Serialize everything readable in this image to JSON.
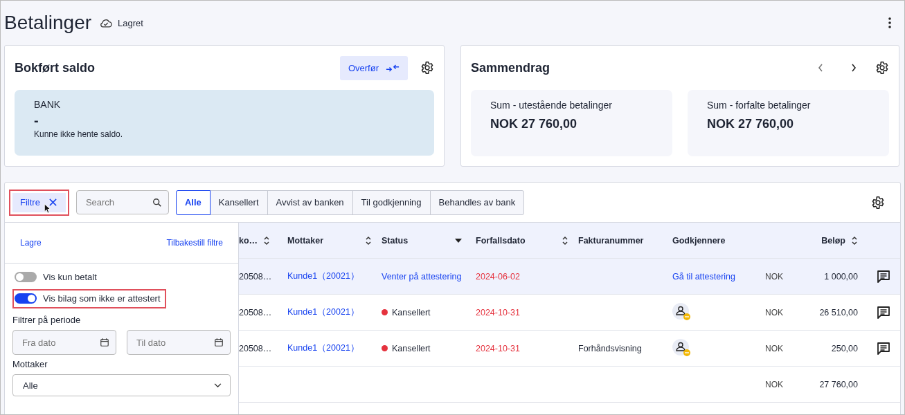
{
  "page": {
    "title": "Betalinger",
    "save_status": "Lagret"
  },
  "balance_card": {
    "title": "Bokført saldo",
    "transfer_button": "Overfør",
    "account": {
      "name": "BANK",
      "amount": "-",
      "message": "Kunne ikke hente saldo."
    }
  },
  "summary_card": {
    "title": "Sammendrag",
    "tiles": [
      {
        "label": "Sum - utestående betalinger",
        "value": "NOK 27 760,00"
      },
      {
        "label": "Sum - forfalte betalinger",
        "value": "NOK 27 760,00"
      }
    ]
  },
  "toolbar": {
    "filter_button": {
      "label": "Filtre",
      "highlighted": true
    },
    "search": {
      "placeholder": "Search"
    },
    "status_tabs": [
      {
        "label": "Alle",
        "selected": true
      },
      {
        "label": "Kansellert",
        "selected": false
      },
      {
        "label": "Avvist av banken",
        "selected": false
      },
      {
        "label": "Til godkjenning",
        "selected": false
      },
      {
        "label": "Behandles av bank",
        "selected": false
      }
    ]
  },
  "filter_panel": {
    "save_link": "Lagre",
    "reset_link": "Tilbakestill filtre",
    "toggles": [
      {
        "label": "Vis kun betalt",
        "on": false,
        "highlighted": false
      },
      {
        "label": "Vis bilag som ikke er attestert",
        "on": true,
        "highlighted": true
      }
    ],
    "period_label": "Filtrer på periode",
    "from_placeholder": "Fra dato",
    "to_placeholder": "Til dato",
    "recipient_label": "Mottaker",
    "recipient_value": "Alle"
  },
  "table": {
    "columns": [
      {
        "label": "ko…",
        "sorted": false
      },
      {
        "label": "Mottaker",
        "sorted": false
      },
      {
        "label": "Status",
        "sorted": true
      },
      {
        "label": "Forfallsdato",
        "sorted": false
      },
      {
        "label": "Fakturanummer"
      },
      {
        "label": "Godkjennere"
      },
      {
        "label": "Beløp",
        "sorted": false
      }
    ],
    "rows": [
      {
        "selected": true,
        "number": "20508…",
        "recipient": "Kunde1（20021）",
        "status": {
          "kind": "pending",
          "label": "Venter på attestering"
        },
        "due": "2024-06-02",
        "approver": {
          "kind": "link",
          "label": "Gå til attestering"
        },
        "currency": "NOK",
        "amount": "1 000,00"
      },
      {
        "selected": false,
        "number": "20508…",
        "recipient": "Kunde1（20021）",
        "status": {
          "kind": "cancelled",
          "label": "Kansellert",
          "color": "#e5323e"
        },
        "due": "2024-10-31",
        "approver": {
          "kind": "avatar"
        },
        "currency": "NOK",
        "amount": "26 510,00"
      },
      {
        "selected": false,
        "number": "20508…",
        "recipient": "Kunde1（20021）",
        "status": {
          "kind": "cancelled",
          "label": "Kansellert",
          "color": "#e5323e"
        },
        "due": "2024-10-31",
        "invoice": "Forhåndsvisning",
        "approver": {
          "kind": "avatar"
        },
        "currency": "NOK",
        "amount": "250,00"
      }
    ],
    "total": {
      "currency": "NOK",
      "amount": "27 760,00"
    }
  }
}
